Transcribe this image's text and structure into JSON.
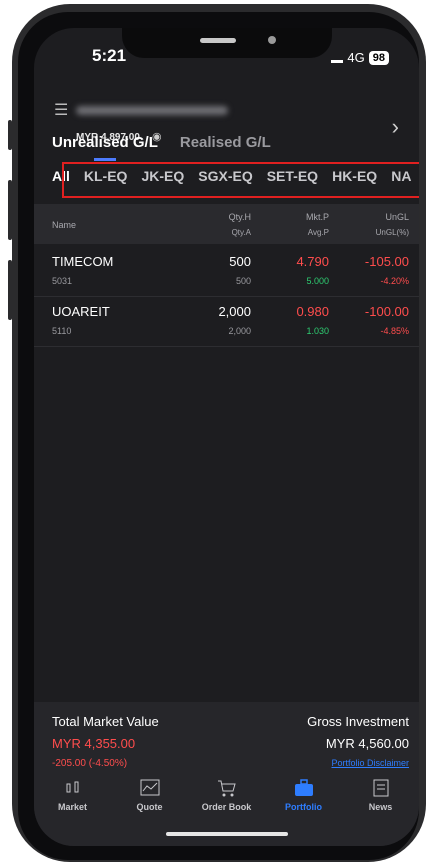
{
  "status_bar": {
    "time": "5:21",
    "network": "4G",
    "battery": "98"
  },
  "header": {
    "balance": "MYR 4,897.00"
  },
  "gl_tabs": {
    "unrealised": "Unrealised G/L",
    "realised": "Realised G/L"
  },
  "market_tabs": [
    "All",
    "KL-EQ",
    "JK-EQ",
    "SGX-EQ",
    "SET-EQ",
    "HK-EQ",
    "NA"
  ],
  "table": {
    "headers": {
      "name": "Name",
      "qty_h": "Qty.H",
      "qty_a": "Qty.A",
      "mkt_p": "Mkt.P",
      "avg_p": "Avg.P",
      "ungl": "UnGL",
      "ungl_pct": "UnGL(%)"
    },
    "rows": [
      {
        "name": "TIMECOM",
        "code": "5031",
        "qty_h": "500",
        "qty_a": "500",
        "mkt_p": "4.790",
        "avg_p": "5.000",
        "ungl": "-105.00",
        "ungl_pct": "-4.20%"
      },
      {
        "name": "UOAREIT",
        "code": "5110",
        "qty_h": "2,000",
        "qty_a": "2,000",
        "mkt_p": "0.980",
        "avg_p": "1.030",
        "ungl": "-100.00",
        "ungl_pct": "-4.85%"
      }
    ]
  },
  "summary": {
    "total_market_value_label": "Total Market Value",
    "total_market_value": "MYR 4,355.00",
    "change": "-205.00 (-4.50%)",
    "gross_investment_label": "Gross Investment",
    "gross_investment": "MYR 4,560.00",
    "disclaimer": "Portfolio Disclaimer"
  },
  "nav": [
    {
      "label": "Market",
      "icon": "market-icon"
    },
    {
      "label": "Quote",
      "icon": "chart-icon"
    },
    {
      "label": "Order Book",
      "icon": "cart-icon"
    },
    {
      "label": "Portfolio",
      "icon": "briefcase-icon"
    },
    {
      "label": "News",
      "icon": "news-icon"
    }
  ],
  "colors": {
    "accent": "#2e7dff",
    "loss": "#ff4d4d",
    "gain": "#2ecc71",
    "highlight": "#e02020"
  }
}
